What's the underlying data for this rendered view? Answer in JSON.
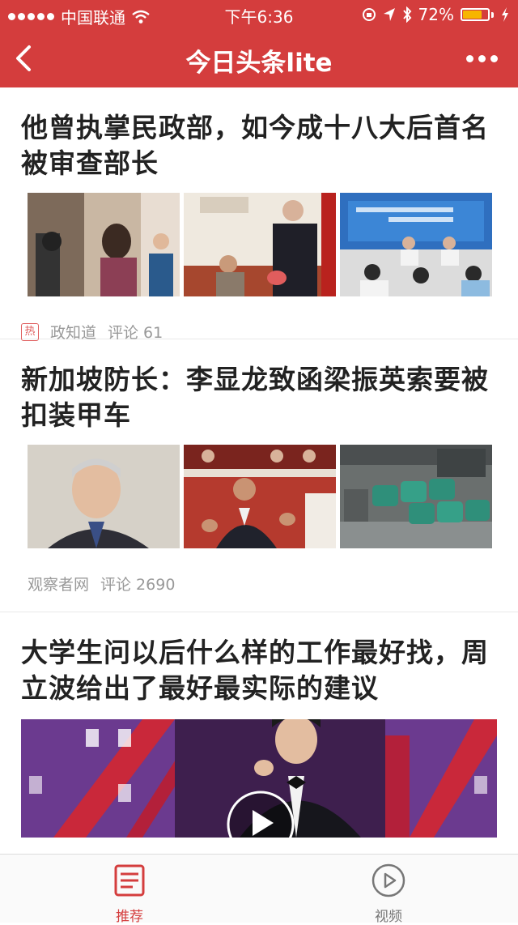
{
  "status_bar": {
    "carrier": "中国联通",
    "time": "下午6:36",
    "battery": "72%",
    "battery_level": 0.72,
    "battery_color": "#f7b500"
  },
  "title_bar": {
    "title": "今日头条lite",
    "back_icon": "chevron-left-icon",
    "more_icon": "more-dots-icon"
  },
  "articles": [
    {
      "headline": "他曾执掌民政部，如今成十八大后首名被审查部长",
      "hot_badge": "热",
      "source": "政知道",
      "comments": "评论 61"
    },
    {
      "headline": "新加坡防长：李显龙致函梁振英索要被扣装甲车",
      "source": "观察者网",
      "comments": "评论 2690"
    },
    {
      "headline": "大学生问以后什么样的工作最好找，周立波给出了最好最实际的建议"
    }
  ],
  "tab_bar": {
    "tabs": [
      {
        "label": "推荐",
        "icon": "news-icon",
        "active": true
      },
      {
        "label": "视频",
        "icon": "play-circle-icon",
        "active": false
      }
    ],
    "active_color": "#d43d3d",
    "inactive_color": "#777777"
  },
  "colors": {
    "brand_red": "#d43d3d",
    "headline_text": "#222222",
    "meta_text": "#999999"
  }
}
